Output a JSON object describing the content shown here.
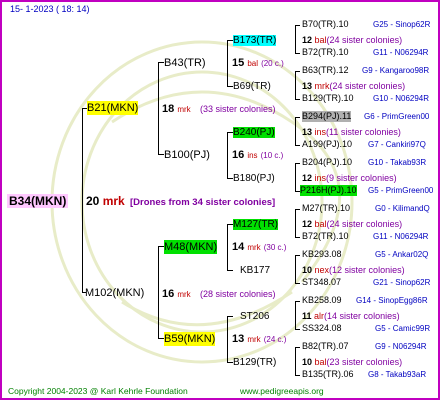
{
  "date_line": "15-   1-2023 (  18:  14)",
  "root": {
    "name": "B34(MKN)",
    "num": "20",
    "code": "mrk",
    "note": "[Drones from 34 sister colonies]"
  },
  "gen1": [
    {
      "name": "B21(MKN)",
      "num": "18",
      "code": "mrk",
      "note": "(33 sister colonies)"
    },
    {
      "name": "M102(MKN)",
      "num": "16",
      "code": "mrk",
      "note": "(28 sister colonies)"
    }
  ],
  "gen2": [
    {
      "name": "B43(TR)",
      "num": "15",
      "code": "bal",
      "note": "(20 c.)"
    },
    {
      "name": "B100(PJ)",
      "num": "16",
      "code": "ins",
      "note": "(10 c.)"
    },
    {
      "name": "M48(MKN)",
      "num": "14",
      "code": "mrk",
      "note": "(30 c.)"
    },
    {
      "name": "B59(MKN)",
      "num": "13",
      "code": "mrk",
      "note": "(24 c.)"
    }
  ],
  "gen3": [
    {
      "name": "B173(TR)",
      "num": "12",
      "code": "bal",
      "note": "(24 sister colonies)"
    },
    {
      "name": "B69(TR)",
      "num": "13",
      "code": "mrk",
      "note": "(24 sister colonies)"
    },
    {
      "name": "B240(PJ)",
      "num": "13",
      "code": "ins",
      "note": "(11 sister colonies)"
    },
    {
      "name": "B180(PJ)",
      "num": "12",
      "code": "ins",
      "note": "(9 sister colonies)"
    },
    {
      "name": "M127(TR)",
      "num": "12",
      "code": "bal",
      "note": "(24 sister colonies)"
    },
    {
      "name": "KB177",
      "num": "10",
      "code": "nex",
      "note": "(12 sister colonies)"
    },
    {
      "name": "ST206",
      "num": "11",
      "code": "alr",
      "note": "(14 sister colonies)"
    },
    {
      "name": "B129(TR)",
      "num": "10",
      "code": "bal",
      "note": "(23 sister colonies)"
    }
  ],
  "gen4": [
    {
      "left": "B70(TR).10",
      "right": "G25 - Sinop62R"
    },
    {
      "left": "B72(TR).10",
      "right": "G11 - N06294R"
    },
    {
      "left": "B63(TR).12",
      "right": "G9 - Kangaroo98R"
    },
    {
      "left": "B129(TR).10",
      "right": "G10 - N06294R"
    },
    {
      "left": "B294(PJ).11",
      "right": "G6 - PrimGreen00"
    },
    {
      "left": "A199(PJ).10",
      "right": "G7 - Cankiri97Q"
    },
    {
      "left": "B204(PJ).10",
      "right": "G10 - Takab93R"
    },
    {
      "left": "P216H(PJ).10",
      "right": "G5 - PrimGreen00"
    },
    {
      "left": "M27(TR).10",
      "right": "G0 - KilimandQ"
    },
    {
      "left": "B72(TR).10",
      "right": "G11 - N06294R"
    },
    {
      "left": "KB293.08",
      "right": "G5 - Ankar02Q"
    },
    {
      "left": "ST348.07",
      "right": "G21 - Sinop62R"
    },
    {
      "left": "KB258.09",
      "right": "G14 - SinopEgg86R"
    },
    {
      "left": "SS324.08",
      "right": "G5 - Camic99R"
    },
    {
      "left": "B82(TR).07",
      "right": "G9 - N06294R"
    },
    {
      "left": "B135(TR).06",
      "right": "G8 - Takab93aR"
    }
  ],
  "footer": {
    "copyright": "Copyright 2004-2023 @ Karl Kehrle Foundation",
    "url": "www.pedigreeapis.org"
  },
  "colors": {
    "frame": "#c000c0",
    "yellow": "#ffff00",
    "green": "#00e000",
    "cyan": "#00ffff",
    "gray": "#b0b0b0",
    "footer": "#008000"
  }
}
